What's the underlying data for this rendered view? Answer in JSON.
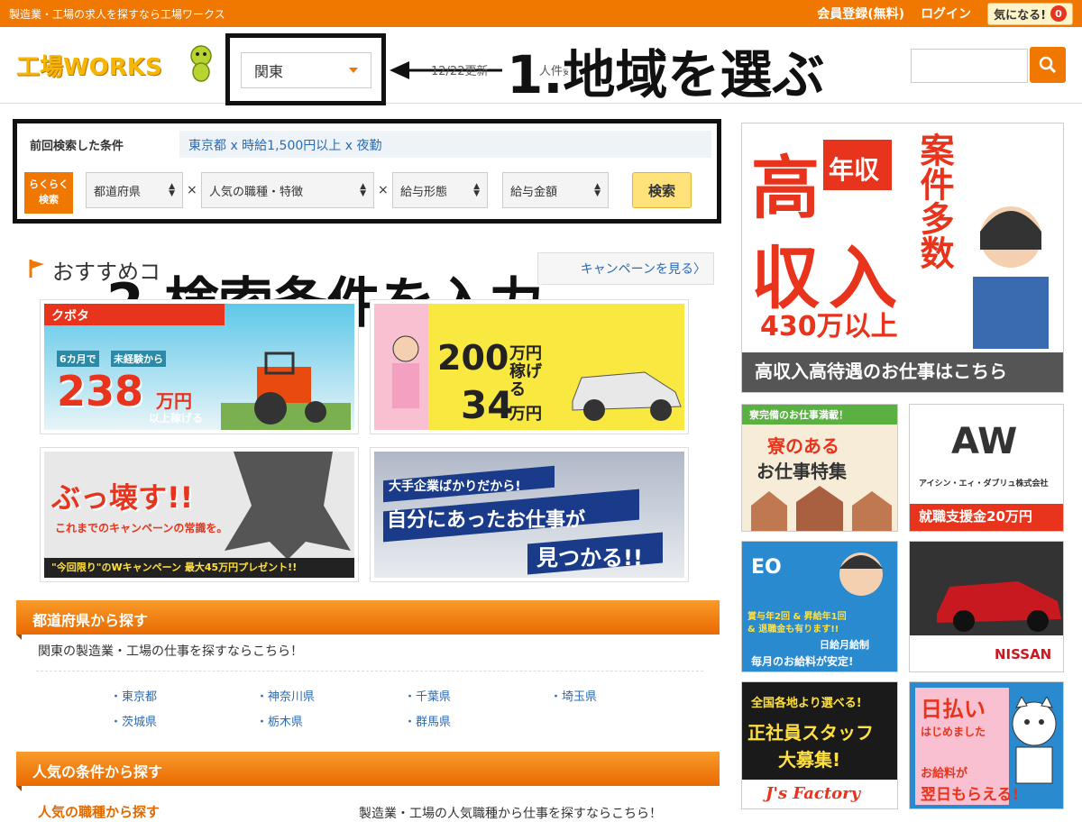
{
  "topbar": {
    "tagline": "製造業・工場の求人を探すなら工場ワークス",
    "register": "会員登録(無料)",
    "login": "ログイン",
    "favorite": "気になる!",
    "favorite_count": "0"
  },
  "header": {
    "logo": "工場WORKS",
    "region_selected": "関東",
    "update_text": "12/22更新",
    "count_text": "人件数",
    "annotation1": "1.地域を選ぶ"
  },
  "conditions": {
    "title": "前回検索した条件",
    "value": "東京都 x 時給1,500円以上 x 夜勤",
    "easy_line1": "らくらく",
    "easy_line2": "検索",
    "select_prefecture": "都道府県",
    "select_job": "人気の職種・特徴",
    "select_pay_type": "給与形態",
    "select_pay_amount": "給与金額",
    "x": "×",
    "submit": "検索",
    "annotation2": "2.検索条件を入力"
  },
  "recommend": {
    "title": "おすすめコ",
    "more": "キャンペーンを見る〉"
  },
  "banners": {
    "kubota_title": "クボタ",
    "kubota_sub1": "6カ月で",
    "kubota_sub2": "未経験から",
    "kubota_amount": "238",
    "kubota_unit": "万円",
    "kubota_note": "以上稼げる",
    "car_amount1": "200",
    "car_unit1": "万円稼げる",
    "car_amount2": "34",
    "car_unit2": "万円",
    "destroy_main": "ぶっ壊す!!",
    "destroy_sub": "これまでのキャンペーンの常識を。",
    "destroy_footer": "\"今回限り\"のWキャンペーン 最大45万円プレゼント!!",
    "big_company1": "大手企業ばかりだから!",
    "big_company2": "自分にあったお仕事が",
    "big_company3": "見つかる!!"
  },
  "prefecture_section": {
    "title": "都道府県から探す",
    "desc": "関東の製造業・工場の仕事を探すならこちら！",
    "links": [
      "東京都",
      "神奈川県",
      "千葉県",
      "埼玉県",
      "茨城県",
      "栃木県",
      "群馬県"
    ]
  },
  "popular_section": {
    "title": "人気の条件から探す",
    "sub_title": "人気の職種から探す",
    "desc": "製造業・工場の人気職種から仕事を探すならこちら！"
  },
  "side_ads": {
    "ad1_big1": "高",
    "ad1_big2": "収",
    "ad1_big3": "入",
    "ad1_tag": "年収",
    "ad1_right": "案件多数",
    "ad1_amount": "430万以上",
    "ad1_footer": "高収入高待遇のお仕事はこちら",
    "ad2_top": "寮完備のお仕事満載！",
    "ad2_main1": "寮のある",
    "ad2_main2": "お仕事特集",
    "ad3_company": "アイシン・エィ・ダブリュ株式会社",
    "ad3_footer": "就職支援金20万円",
    "ad3_logo": "AW",
    "ad4_logo": "EO",
    "ad4_text1": "賞与年2回 & 昇給年1回",
    "ad4_text2": "& 退職金も有ります!!",
    "ad4_text3": "日給月給制",
    "ad4_text4": "毎月のお給料が安定!",
    "ad5_brand": "NISSAN",
    "ad6_top": "全国各地より選べる!",
    "ad6_main1": "正社員スタッフ",
    "ad6_main2": "大募集!",
    "ad6_logo": "J's Factory",
    "ad7_main1": "日払い",
    "ad7_main2": "はじめました",
    "ad7_sub": "お給料が",
    "ad7_sub2": "翌日もらえる!"
  },
  "colors": {
    "orange": "#f07800",
    "link_blue": "#2a6ab0",
    "red": "#e8341c"
  }
}
